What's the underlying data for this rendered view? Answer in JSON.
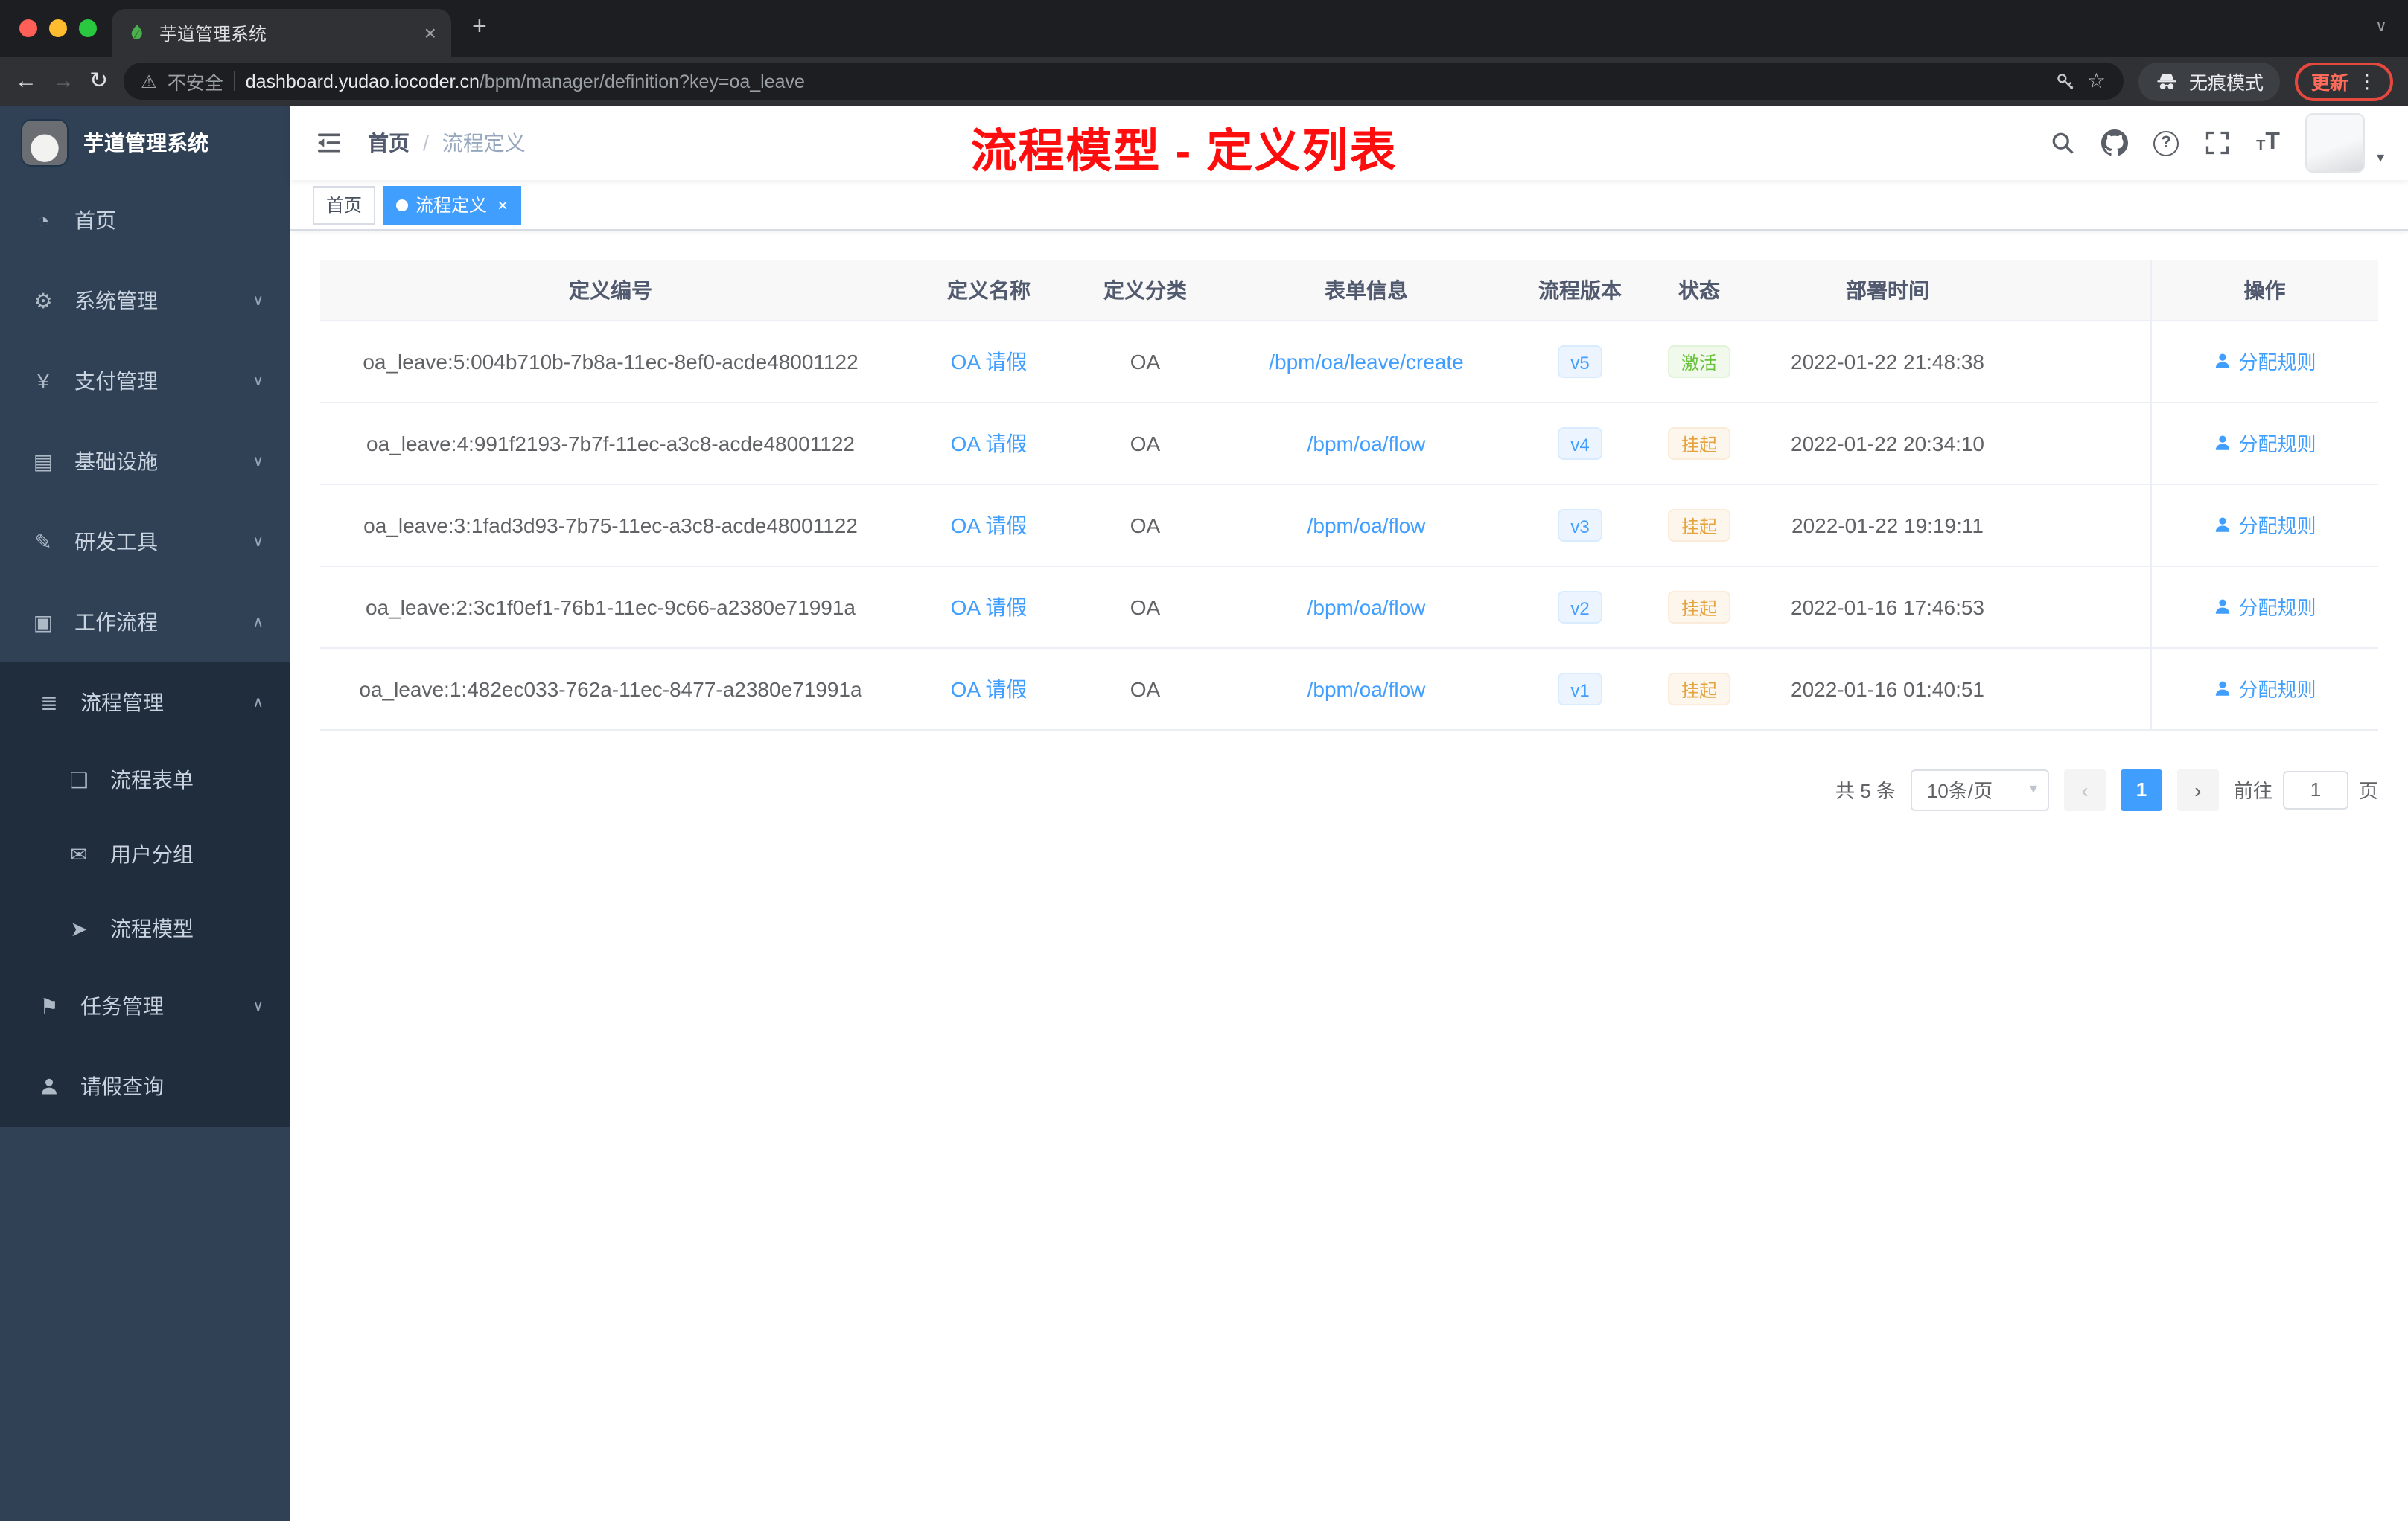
{
  "glyphs": {
    "close": "×",
    "new_tab": "+",
    "back": "←",
    "forward": "→",
    "reload": "↻",
    "warning": "⚠",
    "star": "☆",
    "kebab": "⋮",
    "chevron_down": "∨",
    "chevron_up": "∧",
    "caret_down": "▾",
    "prev": "‹",
    "next": "›",
    "help": "?",
    "font_small": "T",
    "font_big": "T",
    "breadcrumb_sep": "/"
  },
  "colors": {
    "primary": "#409eff",
    "success": "#67c23a",
    "warning": "#e6a23c",
    "annotation_red": "#fd0d0d",
    "sidebar_bg": "#304156",
    "submenu_bg": "#1f2d3d"
  },
  "browser": {
    "tab": {
      "title": "芋道管理系统"
    },
    "toolbar": {
      "security_label": "不安全",
      "url_host": "dashboard.yudao.iocoder.cn",
      "url_path": "/bpm/manager/definition?key=oa_leave",
      "profile_label": "无痕模式",
      "update_label": "更新"
    }
  },
  "sidebar": {
    "logo_title": "芋道管理系统",
    "items": [
      {
        "label": "首页",
        "icon": "dashboard-icon",
        "glyph": "◔"
      },
      {
        "label": "系统管理",
        "icon": "gear-icon",
        "glyph": "⚙",
        "chevron": "down"
      },
      {
        "label": "支付管理",
        "icon": "yen-icon",
        "glyph": "¥",
        "chevron": "down"
      },
      {
        "label": "基础设施",
        "icon": "infrastructure-icon",
        "glyph": "▤",
        "chevron": "down"
      },
      {
        "label": "研发工具",
        "icon": "devtools-icon",
        "glyph": "✎",
        "chevron": "down"
      },
      {
        "label": "工作流程",
        "icon": "workflow-icon",
        "glyph": "▣",
        "chevron": "up",
        "expanded": true
      }
    ],
    "workflow_children": [
      {
        "label": "流程管理",
        "icon": "process-list-icon",
        "glyph": "≣",
        "chevron": "up",
        "expanded": true
      },
      {
        "label": "流程表单",
        "icon": "form-icon",
        "glyph": "❏"
      },
      {
        "label": "用户分组",
        "icon": "user-group-icon",
        "glyph": "✉"
      },
      {
        "label": "流程模型",
        "icon": "model-icon",
        "glyph": "➤"
      },
      {
        "label": "任务管理",
        "icon": "task-icon",
        "glyph": "⚑",
        "chevron": "down"
      },
      {
        "label": "请假查询",
        "icon": "person-icon",
        "glyph": ""
      }
    ]
  },
  "navbar": {
    "breadcrumb": {
      "home": "首页",
      "current": "流程定义"
    },
    "annotation": "流程模型 - 定义列表"
  },
  "tagsview": {
    "tags": [
      {
        "label": "首页",
        "active": false
      },
      {
        "label": "流程定义",
        "active": true,
        "closable": true
      }
    ]
  },
  "table": {
    "columns": [
      "定义编号",
      "定义名称",
      "定义分类",
      "表单信息",
      "流程版本",
      "状态",
      "部署时间",
      "操作"
    ],
    "rows": [
      {
        "id": "oa_leave:5:004b710b-7b8a-11ec-8ef0-acde48001122",
        "name": "OA 请假",
        "category": "OA",
        "form": "/bpm/oa/leave/create",
        "version": "v5",
        "status": "激活",
        "status_type": "success",
        "deploy_time": "2022-01-22 21:48:38",
        "action": "分配规则"
      },
      {
        "id": "oa_leave:4:991f2193-7b7f-11ec-a3c8-acde48001122",
        "name": "OA 请假",
        "category": "OA",
        "form": "/bpm/oa/flow",
        "version": "v4",
        "status": "挂起",
        "status_type": "warning",
        "deploy_time": "2022-01-22 20:34:10",
        "action": "分配规则"
      },
      {
        "id": "oa_leave:3:1fad3d93-7b75-11ec-a3c8-acde48001122",
        "name": "OA 请假",
        "category": "OA",
        "form": "/bpm/oa/flow",
        "version": "v3",
        "status": "挂起",
        "status_type": "warning",
        "deploy_time": "2022-01-22 19:19:11",
        "action": "分配规则"
      },
      {
        "id": "oa_leave:2:3c1f0ef1-76b1-11ec-9c66-a2380e71991a",
        "name": "OA 请假",
        "category": "OA",
        "form": "/bpm/oa/flow",
        "version": "v2",
        "status": "挂起",
        "status_type": "warning",
        "deploy_time": "2022-01-16 17:46:53",
        "action": "分配规则"
      },
      {
        "id": "oa_leave:1:482ec033-762a-11ec-8477-a2380e71991a",
        "name": "OA 请假",
        "category": "OA",
        "form": "/bpm/oa/flow",
        "version": "v1",
        "status": "挂起",
        "status_type": "warning",
        "deploy_time": "2022-01-16 01:40:51",
        "action": "分配规则"
      }
    ]
  },
  "pagination": {
    "total": "共 5 条",
    "page_size": "10条/页",
    "current_page": "1",
    "goto_label": "前往",
    "goto_value": "1",
    "unit_label": "页"
  }
}
